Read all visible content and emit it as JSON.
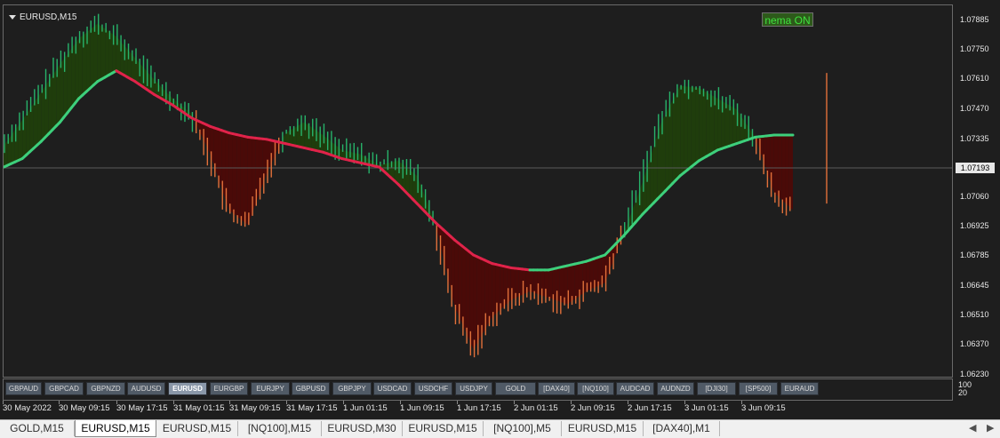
{
  "chart_title": "EURUSD,M15",
  "indicator_button": "nema ON",
  "current_price": "1.07193",
  "price_axis": [
    "1.07885",
    "1.07750",
    "1.07610",
    "1.07470",
    "1.07335",
    "1.07060",
    "1.06925",
    "1.06785",
    "1.06645",
    "1.06510",
    "1.06370",
    "1.06230"
  ],
  "sub_axis": [
    "100",
    "20"
  ],
  "symbol_buttons": [
    "GBPAUD",
    "GBPCAD",
    "GBPNZD",
    "AUDUSD",
    "EURUSD",
    "EURGBP",
    "EURJPY",
    "GBPUSD",
    "GBPJPY",
    "USDCAD",
    "USDCHF",
    "USDJPY",
    "GOLD",
    "[DAX40]",
    "[NQ100]",
    "AUDCAD",
    "AUDNZD",
    "[DJI30]",
    "[SP500]",
    "EURAUD"
  ],
  "active_symbol": "EURUSD",
  "time_axis": [
    "30 May 2022",
    "30 May 09:15",
    "30 May 17:15",
    "31 May 01:15",
    "31 May 09:15",
    "31 May 17:15",
    "1 Jun 01:15",
    "1 Jun 09:15",
    "1 Jun 17:15",
    "2 Jun 01:15",
    "2 Jun 09:15",
    "2 Jun 17:15",
    "3 Jun 01:15",
    "3 Jun 09:15"
  ],
  "tabs": [
    "GOLD,M15",
    "EURUSD,M15",
    "EURUSD,M15",
    "[NQ100],M15",
    "EURUSD,M30",
    "EURUSD,M15",
    "[NQ100],M5",
    "EURUSD,M15",
    "[DAX40],M1"
  ],
  "active_tab": 1,
  "colors": {
    "bull_bar": "#27b36a",
    "bear_bar": "#e2703a",
    "ma_up": "#3dd07c",
    "ma_down": "#e0234a",
    "fill_up": "#1f3d0c",
    "fill_down": "#4a0a08"
  },
  "chart_data": {
    "type": "line",
    "title": "EURUSD,M15",
    "ylim": [
      1.0623,
      1.0795
    ],
    "x_ticks": [
      "30 May 2022",
      "30 May 09:15",
      "30 May 17:15",
      "31 May 01:15",
      "31 May 09:15",
      "31 May 17:15",
      "1 Jun 01:15",
      "1 Jun 09:15",
      "1 Jun 17:15",
      "2 Jun 01:15",
      "2 Jun 09:15",
      "2 Jun 17:15",
      "3 Jun 01:15",
      "3 Jun 09:15"
    ],
    "price": [
      1.073,
      1.0742,
      1.0755,
      1.0768,
      1.078,
      1.0787,
      1.0781,
      1.0771,
      1.0761,
      1.0752,
      1.0745,
      1.0726,
      1.07,
      1.0693,
      1.0717,
      1.0736,
      1.0741,
      1.0735,
      1.0728,
      1.0726,
      1.0721,
      1.0723,
      1.0716,
      1.0693,
      1.0655,
      1.0635,
      1.065,
      1.0658,
      1.0662,
      1.0659,
      1.0656,
      1.0662,
      1.0666,
      1.0689,
      1.0713,
      1.0741,
      1.0758,
      1.0757,
      1.0752,
      1.0747,
      1.0734,
      1.0708,
      1.07
    ],
    "ma": [
      1.072,
      1.0724,
      1.0732,
      1.0741,
      1.0752,
      1.076,
      1.0765,
      1.076,
      1.0754,
      1.0749,
      1.0743,
      1.0739,
      1.0736,
      1.0734,
      1.0733,
      1.0731,
      1.0729,
      1.0727,
      1.0724,
      1.0722,
      1.072,
      1.0712,
      1.0703,
      1.0694,
      1.0686,
      1.0679,
      1.0675,
      1.0673,
      1.0672,
      1.0672,
      1.0674,
      1.0676,
      1.0679,
      1.0688,
      1.0698,
      1.0707,
      1.0716,
      1.0723,
      1.0728,
      1.0731,
      1.0734,
      1.0735,
      1.0735
    ]
  }
}
